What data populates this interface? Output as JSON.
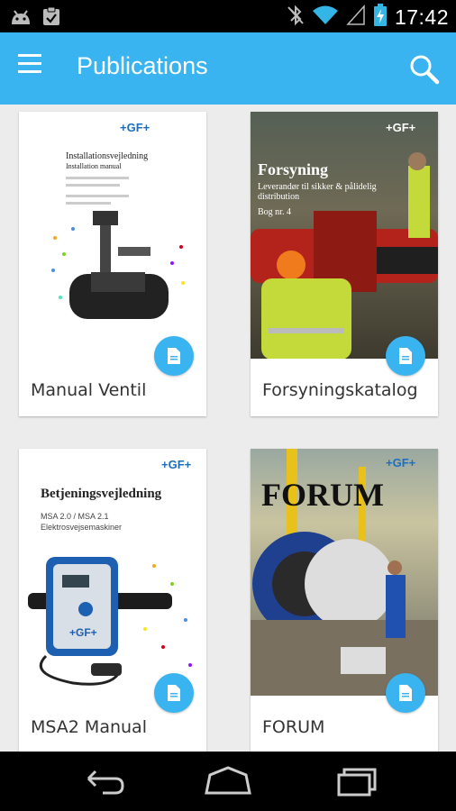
{
  "status_bar": {
    "time": "17:42",
    "icons": [
      "android-icon",
      "clipboard-check-icon",
      "bluetooth-off-icon",
      "wifi-icon",
      "signal-icon",
      "battery-charging-icon"
    ]
  },
  "app_bar": {
    "title": "Publications",
    "menu_icon": "hamburger-menu-icon",
    "search_icon": "search-icon"
  },
  "publications": [
    {
      "title": "Manual Ventil",
      "cover": {
        "brand": "+GF+",
        "heading": "Installationsvejledning",
        "subheading": "Installation manual"
      }
    },
    {
      "title": "Forsyningskatalog",
      "cover": {
        "brand": "+GF+",
        "heading": "Forsyning",
        "subheading": "Leverandør til sikker & pålidelig distribution",
        "issue": "Bog nr. 4"
      }
    },
    {
      "title": "MSA2 Manual",
      "cover": {
        "brand": "+GF+",
        "heading": "Betjeningsvejledning",
        "subheading": "MSA 2.0 / MSA 2.1",
        "subheading2": "Elektrosvejsemaskiner"
      }
    },
    {
      "title": "FORUM",
      "cover": {
        "brand": "+GF+",
        "heading": "FORUM"
      }
    }
  ],
  "colors": {
    "accent": "#39b4f0",
    "background": "#ececec",
    "status_bar": "#000000",
    "brand_blue": "#1c6fbf"
  },
  "nav_bar": {
    "icons": [
      "back-icon",
      "home-icon",
      "recent-apps-icon"
    ]
  }
}
